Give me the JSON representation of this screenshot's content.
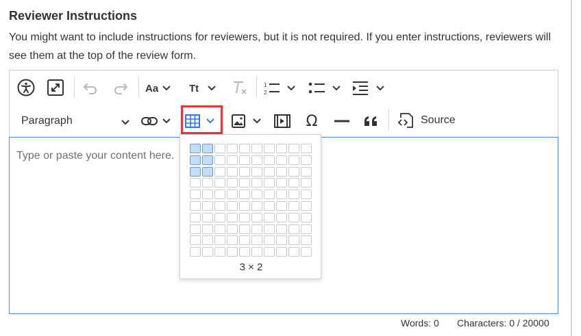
{
  "section": {
    "title": "Reviewer Instructions",
    "description": "You might want to include instructions for reviewers, but it is not required. If you enter instructions, reviewers will see them at the top of the review form."
  },
  "toolbar": {
    "row1": [
      {
        "name": "accessibility-help-button",
        "icon": "accessibility-icon"
      },
      {
        "name": "fullscreen-button",
        "icon": "maximize-icon"
      },
      {
        "name": "undo-button",
        "icon": "undo-icon",
        "disabled": true
      },
      {
        "name": "redo-button",
        "icon": "redo-icon",
        "disabled": true
      },
      {
        "name": "font-size-dropdown",
        "label": "Aa"
      },
      {
        "name": "text-transform-dropdown",
        "label": "Tt"
      },
      {
        "name": "remove-format-button",
        "label": "T",
        "disabled": true
      },
      {
        "name": "numbered-list-dropdown",
        "icon": "numbered-list-icon"
      },
      {
        "name": "bulleted-list-dropdown",
        "icon": "bulleted-list-icon"
      },
      {
        "name": "indent-dropdown",
        "icon": "indent-icon"
      }
    ],
    "paragraph_label": "Paragraph",
    "source_label": "Source",
    "accent_color": "#2977ff",
    "highlight_color": "#e5343a"
  },
  "editor": {
    "placeholder": "Type or paste your content here."
  },
  "table_dropdown": {
    "rows": 10,
    "columns": 10,
    "selected_rows": 3,
    "selected_columns": 2,
    "size_label": "3 × 2"
  },
  "footer": {
    "words": "Words: 0",
    "characters": "Characters: 0 / 20000"
  }
}
